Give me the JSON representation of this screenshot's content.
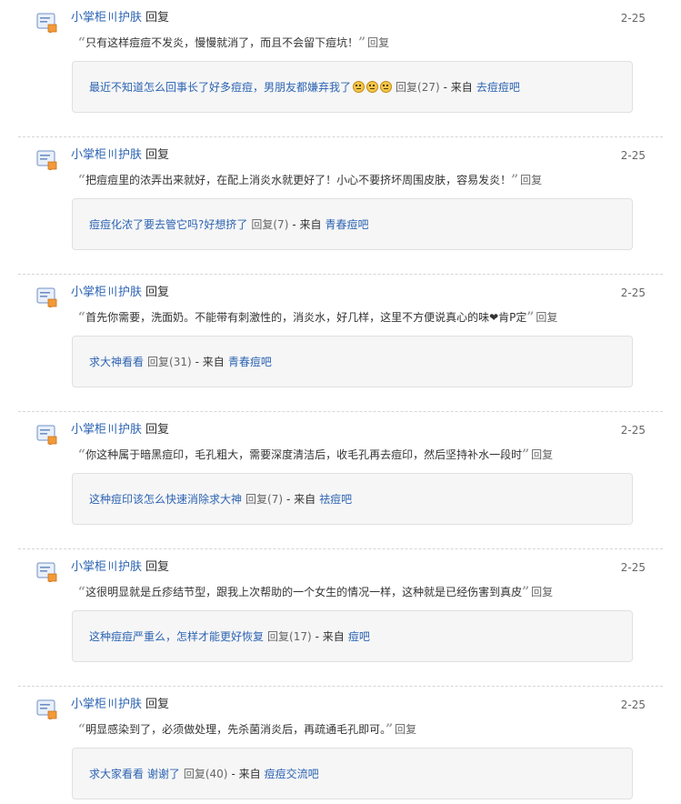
{
  "colors": {
    "link": "#2d64b3",
    "text": "#333333",
    "muted": "#666666",
    "box_bg": "#f6f6f6",
    "box_border": "#e0e0e0"
  },
  "icon": "reply-notification-icon",
  "items": [
    {
      "author": "小掌柜〣护肤",
      "action": "回复",
      "date": "2-25",
      "quote": "只有这样痘痘不发炎，慢慢就消了，而且不会留下痘坑！",
      "quote_reply": "回复",
      "thread_title": "最近不知道怎么回事长了好多痘痘，男朋友都嫌弃我了",
      "emoji_count": 3,
      "reply_count": "回复(27)",
      "from_label": "- 来自",
      "forum": "去痘痘吧"
    },
    {
      "author": "小掌柜〣护肤",
      "action": "回复",
      "date": "2-25",
      "quote": "把痘痘里的浓弄出来就好，在配上消炎水就更好了！小心不要挤坏周围皮肤，容易发炎！",
      "quote_reply": "回复",
      "thread_title": "痘痘化浓了要去管它吗?好想挤了",
      "emoji_count": 0,
      "reply_count": "回复(7)",
      "from_label": "- 来自",
      "forum": "青春痘吧"
    },
    {
      "author": "小掌柜〣护肤",
      "action": "回复",
      "date": "2-25",
      "quote": "首先你需要，洗面奶。不能带有刺激性的，消炎水，好几样，这里不方便说真心的味❤肯P定",
      "quote_reply": "回复",
      "thread_title": "求大神看看",
      "emoji_count": 0,
      "reply_count": "回复(31)",
      "from_label": "- 来自",
      "forum": "青春痘吧"
    },
    {
      "author": "小掌柜〣护肤",
      "action": "回复",
      "date": "2-25",
      "quote": "你这种属于暗黑痘印，毛孔粗大，需要深度清洁后，收毛孔再去痘印，然后坚持补水一段时",
      "quote_reply": "回复",
      "thread_title": "这种痘印该怎么快速消除求大神",
      "emoji_count": 0,
      "reply_count": "回复(7)",
      "from_label": "- 来自",
      "forum": "祛痘吧"
    },
    {
      "author": "小掌柜〣护肤",
      "action": "回复",
      "date": "2-25",
      "quote": "这很明显就是丘疹结节型，跟我上次帮助的一个女生的情况一样，这种就是已经伤害到真皮",
      "quote_reply": "回复",
      "thread_title": "这种痘痘严重么，怎样才能更好恢复",
      "emoji_count": 0,
      "reply_count": "回复(17)",
      "from_label": "- 来自",
      "forum": "痘吧"
    },
    {
      "author": "小掌柜〣护肤",
      "action": "回复",
      "date": "2-25",
      "quote": "明显感染到了，必须做处理，先杀菌消炎后，再疏通毛孔即可。",
      "quote_reply": "回复",
      "thread_title": "求大家看看  谢谢了",
      "emoji_count": 0,
      "reply_count": "回复(40)",
      "from_label": "- 来自",
      "forum": "痘痘交流吧"
    }
  ]
}
